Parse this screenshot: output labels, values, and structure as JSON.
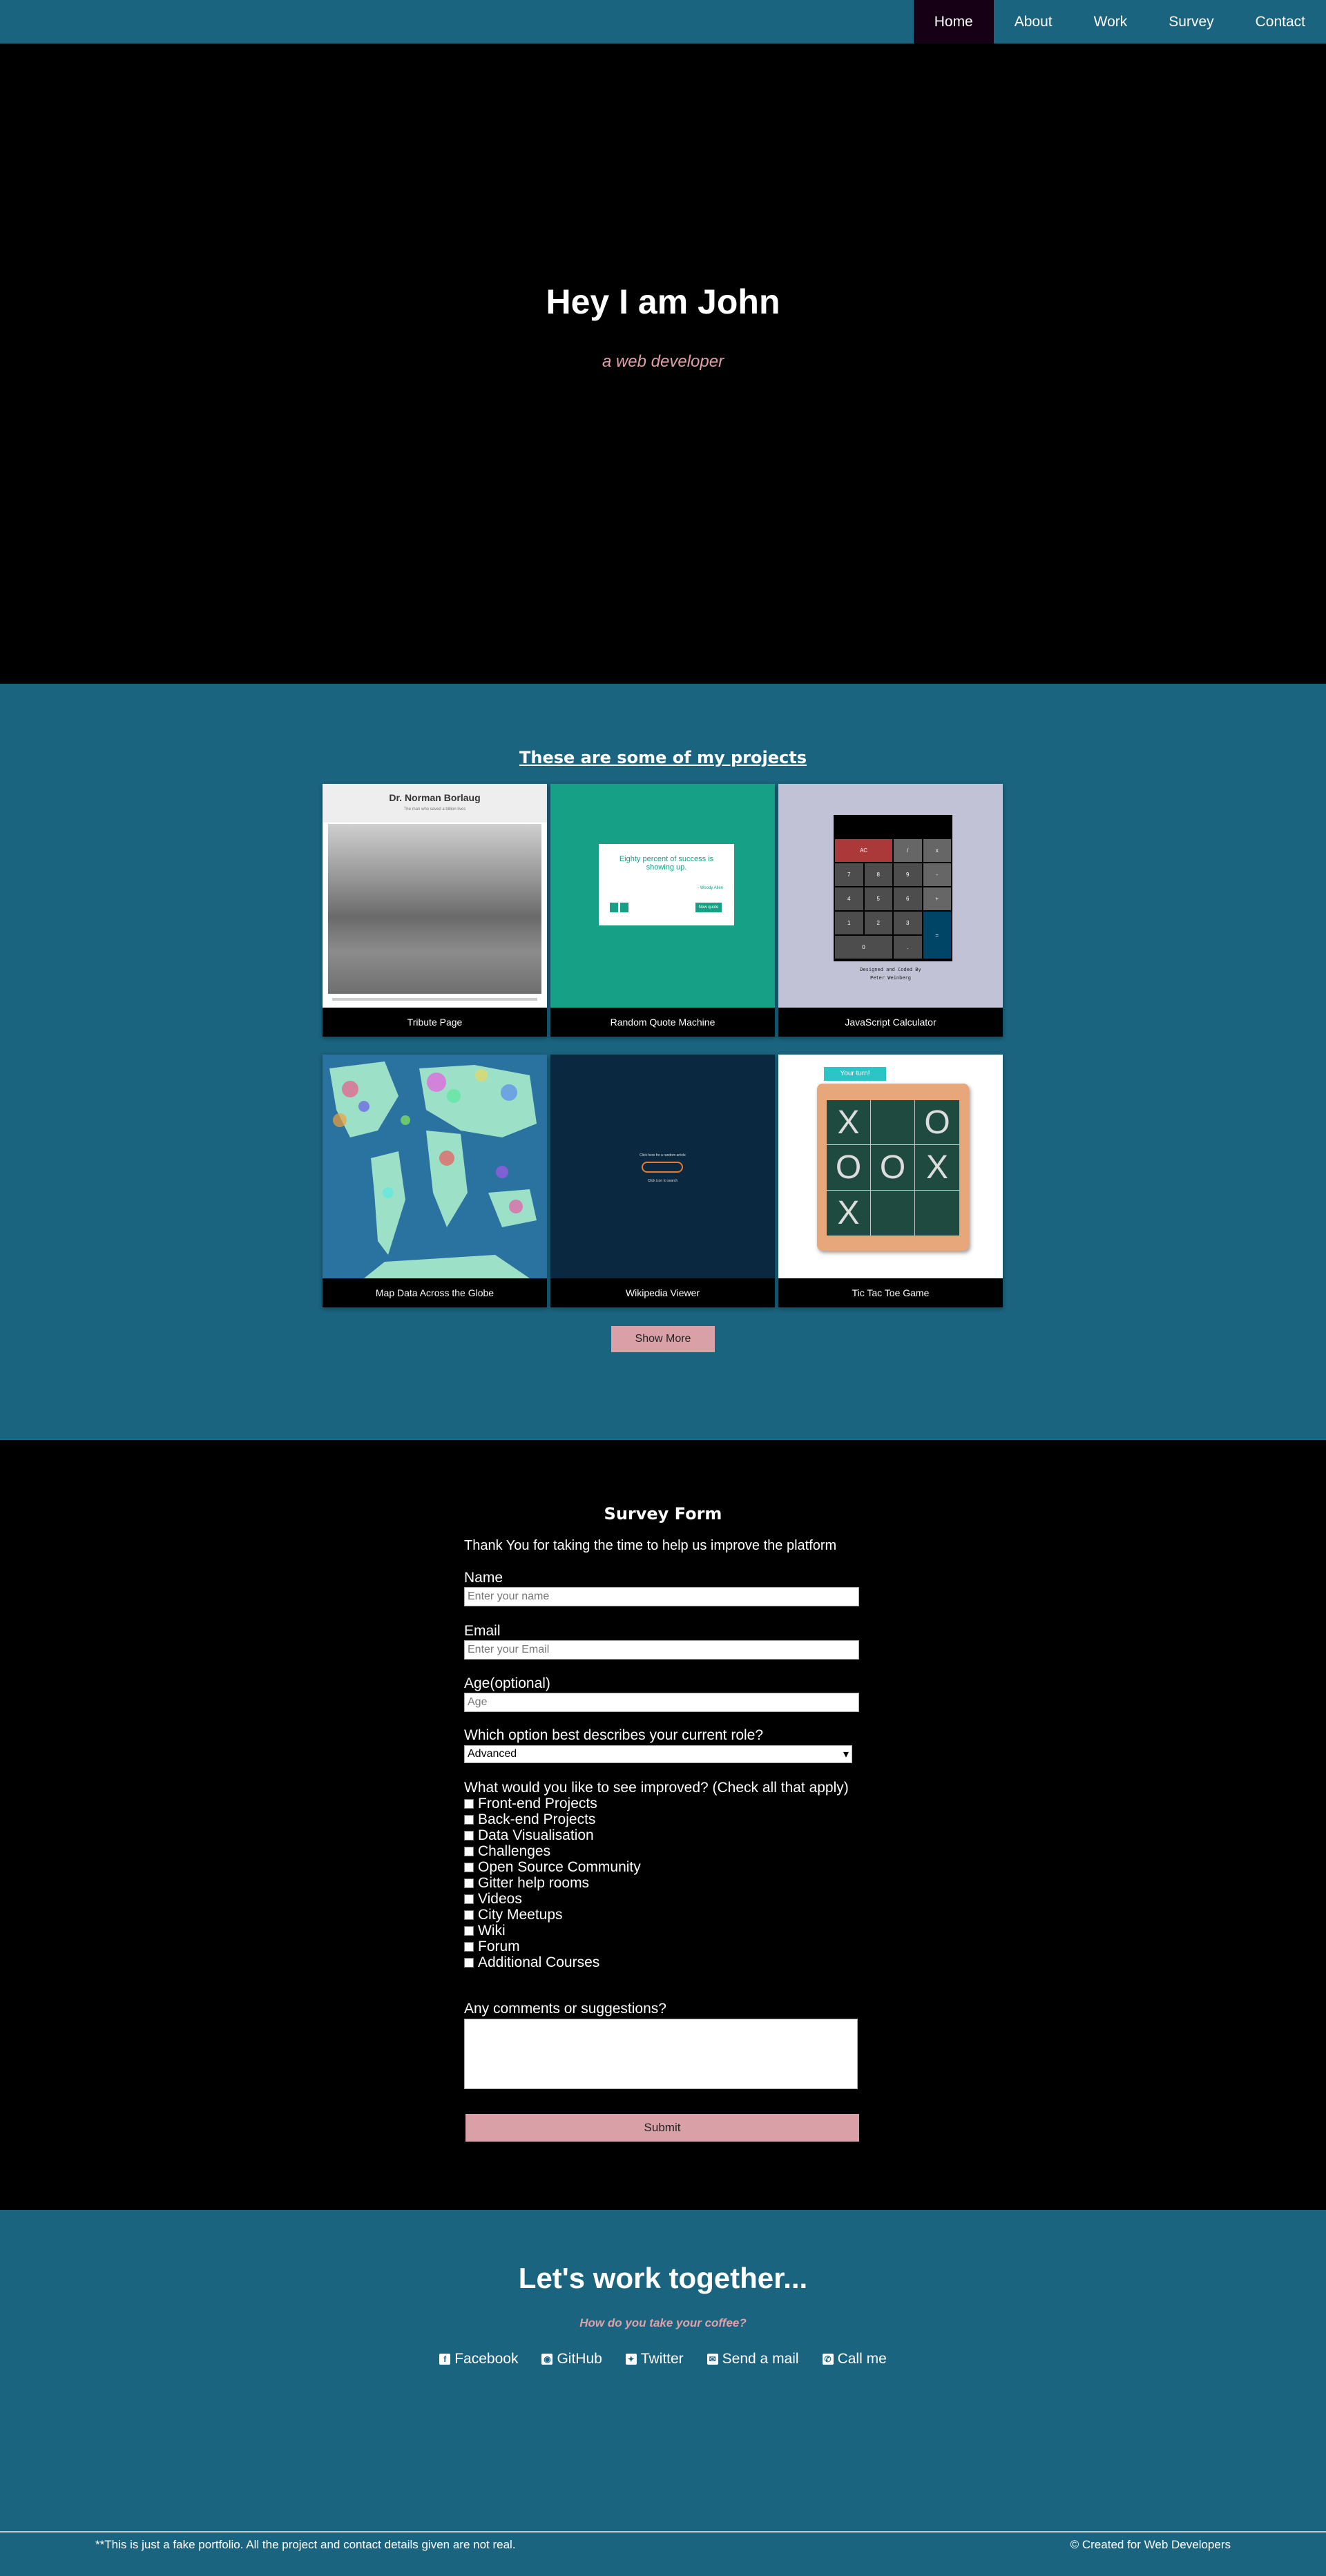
{
  "nav": {
    "items": [
      "Home",
      "About",
      "Work",
      "Survey",
      "Contact"
    ],
    "active": "Home"
  },
  "hero": {
    "title": "Hey I am John",
    "subtitle": "a web developer"
  },
  "projects": {
    "heading": "These are some of my projects",
    "tiles": [
      {
        "caption": "Tribute Page",
        "thumb_title": "Dr. Norman Borlaug",
        "thumb_sub": "The man who saved a billion lives"
      },
      {
        "caption": "Random Quote Machine",
        "quote": "Eighty percent of success is showing up.",
        "author": "- Woody Allen",
        "new_quote": "New quote"
      },
      {
        "caption": "JavaScript Calculator",
        "keys": [
          "AC",
          "/",
          "x",
          "7",
          "8",
          "9",
          "-",
          "4",
          "5",
          "6",
          "+",
          "1",
          "2",
          "3",
          "=",
          "0",
          "."
        ],
        "footer1": "Designed and Coded By",
        "footer2": "Peter Weinberg"
      },
      {
        "caption": "Map Data Across the Globe"
      },
      {
        "caption": "Wikipedia Viewer",
        "top": "Click here for a random article",
        "bottom": "Click icon to search"
      },
      {
        "caption": "Tic Tac Toe Game",
        "badge": "Your turn!",
        "board": [
          "X",
          "",
          "O",
          "O",
          "O",
          "X",
          "X",
          "",
          ""
        ]
      }
    ],
    "show_more": "Show More"
  },
  "survey": {
    "title": "Survey Form",
    "description": "Thank You for taking the time to help us improve the platform",
    "name_label": "Name",
    "name_placeholder": "Enter your name",
    "email_label": "Email",
    "email_placeholder": "Enter your Email",
    "age_label": "Age(optional)",
    "age_placeholder": "Age",
    "role_label": "Which option best describes your current role?",
    "role_selected": "Advanced",
    "improve_label": "What would you like to see improved? (Check all that apply)",
    "options": [
      "Front-end Projects",
      "Back-end Projects",
      "Data Visualisation",
      "Challenges",
      "Open Source Community",
      "Gitter help rooms",
      "Videos",
      "City Meetups",
      "Wiki",
      "Forum",
      "Additional Courses"
    ],
    "comments_label": "Any comments or suggestions?",
    "submit": "Submit"
  },
  "contact": {
    "title": "Let's work together...",
    "subtitle": "How do you take your coffee?",
    "links": [
      {
        "label": "Facebook",
        "icon": "facebook-icon"
      },
      {
        "label": "GitHub",
        "icon": "github-icon"
      },
      {
        "label": "Twitter",
        "icon": "twitter-icon"
      },
      {
        "label": "Send a mail",
        "icon": "mail-icon"
      },
      {
        "label": "Call me",
        "icon": "phone-icon"
      }
    ]
  },
  "footer": {
    "left": "**This is just a fake portfolio. All the project and contact details given are not real.",
    "right": "© Created for Web Developers"
  }
}
